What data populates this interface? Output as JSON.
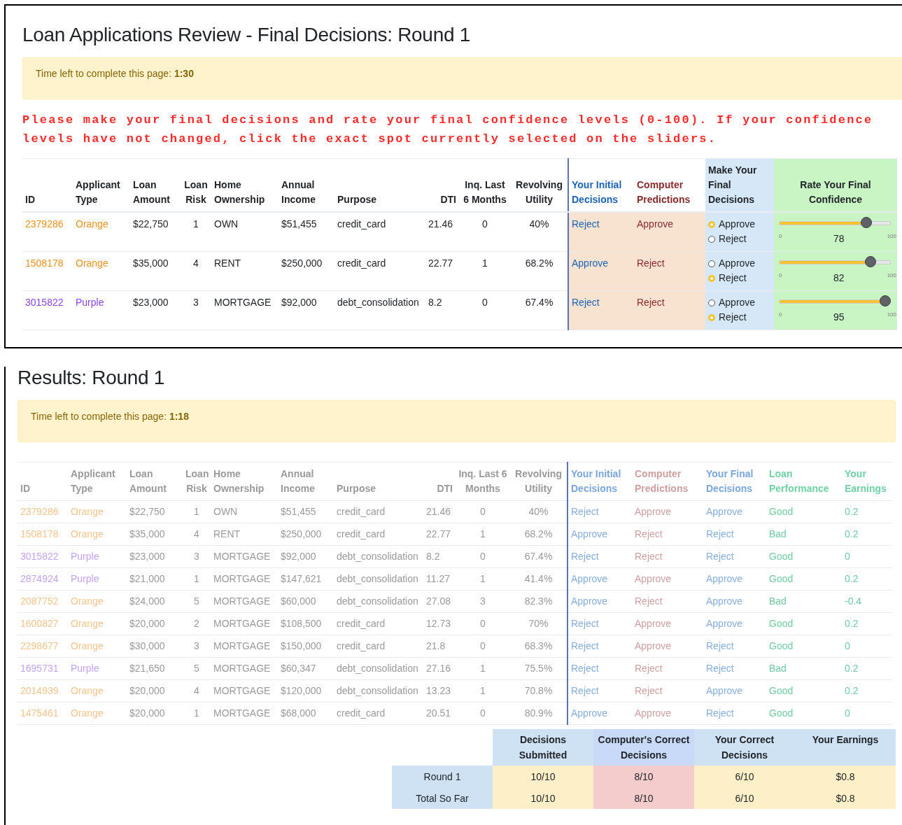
{
  "review": {
    "title": "Loan Applications Review - Final Decisions: Round 1",
    "timer": {
      "label": "Time left to complete this page:",
      "value": "1:30"
    },
    "instructions": "Please make your final decisions and rate your final confidence levels (0-100). If your confidence levels have not changed, click the exact spot currently selected on the sliders.",
    "columns": [
      {
        "label": "ID",
        "kind": "plain"
      },
      {
        "label": "Applicant Type",
        "kind": "plain"
      },
      {
        "label": "Loan Amount",
        "kind": "plain"
      },
      {
        "label": "Loan Risk",
        "kind": "plain"
      },
      {
        "label": "Home Ownership",
        "kind": "plain"
      },
      {
        "label": "Annual Income",
        "kind": "plain"
      },
      {
        "label": "Purpose",
        "kind": "plain"
      },
      {
        "label": "DTI",
        "kind": "plain"
      },
      {
        "label": "Inq. Last 6 Months",
        "kind": "plain"
      },
      {
        "label": "Revolving Utility",
        "kind": "plain"
      },
      {
        "label": "Your Initial Decisions",
        "kind": "initial"
      },
      {
        "label": "Computer Predictions",
        "kind": "computer"
      },
      {
        "label": "Make Your Final Decisions",
        "kind": "final"
      },
      {
        "label": "Rate Your Final Confidence",
        "kind": "confidence"
      }
    ],
    "rows": [
      {
        "color": "#f0901e",
        "cells": [
          "2379286",
          "Orange",
          "$22,750",
          "1",
          "OWN",
          "$51,455",
          "credit_card",
          "21.46",
          "0",
          "40%",
          "Reject",
          "Approve"
        ],
        "final": [
          {
            "label": "Approve",
            "selected": true
          },
          {
            "label": "Reject",
            "selected": false
          }
        ],
        "confidence": {
          "level": 0.78,
          "min": "0",
          "max": "100",
          "reading": "78"
        }
      },
      {
        "color": "#f0901e",
        "cells": [
          "1508178",
          "Orange",
          "$35,000",
          "4",
          "RENT",
          "$250,000",
          "credit_card",
          "22.77",
          "1",
          "68.2%",
          "Approve",
          "Reject"
        ],
        "final": [
          {
            "label": "Approve",
            "selected": false
          },
          {
            "label": "Reject",
            "selected": true
          }
        ],
        "confidence": {
          "level": 0.82,
          "min": "0",
          "max": "100",
          "reading": "82"
        }
      },
      {
        "color": "#8b44f0",
        "cells": [
          "3015822",
          "Purple",
          "$23,000",
          "3",
          "MORTGAGE",
          "$92,000",
          "debt_consolidation",
          "8.2",
          "0",
          "67.4%",
          "Reject",
          "Reject"
        ],
        "final": [
          {
            "label": "Approve",
            "selected": false
          },
          {
            "label": "Reject",
            "selected": true
          }
        ],
        "confidence": {
          "level": 0.95,
          "min": "0",
          "max": "100",
          "reading": "95"
        }
      }
    ]
  },
  "results": {
    "title": "Results: Round 1",
    "timer": {
      "label": "Time left to complete this page:",
      "value": "1:18"
    },
    "columns": [
      {
        "label": "ID",
        "kind": "plain"
      },
      {
        "label": "Applicant Type",
        "kind": "plain"
      },
      {
        "label": "Loan Amount",
        "kind": "plain"
      },
      {
        "label": "Loan Risk",
        "kind": "plain"
      },
      {
        "label": "Home Ownership",
        "kind": "plain"
      },
      {
        "label": "Annual Income",
        "kind": "plain"
      },
      {
        "label": "Purpose",
        "kind": "plain"
      },
      {
        "label": "DTI",
        "kind": "plain"
      },
      {
        "label": "Inq. Last 6 Months",
        "kind": "plain"
      },
      {
        "label": "Revolving Utility",
        "kind": "plain"
      },
      {
        "label": "Your Initial Decisions",
        "kind": "initial"
      },
      {
        "label": "Computer Predictions",
        "kind": "computer"
      },
      {
        "label": "Your Final Decisions",
        "kind": "final"
      },
      {
        "label": "Loan Performance",
        "kind": "performance"
      },
      {
        "label": "Your Earnings",
        "kind": "earnings"
      }
    ],
    "rows": [
      {
        "color": "#f7c48e",
        "cells": [
          "2379286",
          "Orange",
          "$22,750",
          "1",
          "OWN",
          "$51,455",
          "credit_card",
          "21.46",
          "0",
          "40%",
          "Reject",
          "Approve",
          "Approve",
          "Good",
          "0.2"
        ]
      },
      {
        "color": "#f7c48e",
        "cells": [
          "1508178",
          "Orange",
          "$35,000",
          "4",
          "RENT",
          "$250,000",
          "credit_card",
          "22.77",
          "1",
          "68.2%",
          "Approve",
          "Reject",
          "Reject",
          "Bad",
          "0.2"
        ]
      },
      {
        "color": "#c4a3f7",
        "cells": [
          "3015822",
          "Purple",
          "$23,000",
          "3",
          "MORTGAGE",
          "$92,000",
          "debt_consolidation",
          "8.2",
          "0",
          "67.4%",
          "Reject",
          "Reject",
          "Reject",
          "Good",
          "0"
        ]
      },
      {
        "color": "#c4a3f7",
        "cells": [
          "2874924",
          "Purple",
          "$21,000",
          "1",
          "MORTGAGE",
          "$147,621",
          "debt_consolidation",
          "11.27",
          "1",
          "41.4%",
          "Approve",
          "Approve",
          "Approve",
          "Good",
          "0.2"
        ]
      },
      {
        "color": "#f7c48e",
        "cells": [
          "2087752",
          "Orange",
          "$24,000",
          "5",
          "MORTGAGE",
          "$60,000",
          "debt_consolidation",
          "27.08",
          "3",
          "82.3%",
          "Approve",
          "Reject",
          "Approve",
          "Bad",
          "-0.4"
        ]
      },
      {
        "color": "#f7c48e",
        "cells": [
          "1600827",
          "Orange",
          "$20,000",
          "2",
          "MORTGAGE",
          "$108,500",
          "credit_card",
          "12.73",
          "0",
          "70%",
          "Reject",
          "Approve",
          "Approve",
          "Good",
          "0.2"
        ]
      },
      {
        "color": "#f7c48e",
        "cells": [
          "2298677",
          "Orange",
          "$30,000",
          "3",
          "MORTGAGE",
          "$150,000",
          "credit_card",
          "21.8",
          "0",
          "68.3%",
          "Reject",
          "Approve",
          "Reject",
          "Good",
          "0"
        ]
      },
      {
        "color": "#c4a3f7",
        "cells": [
          "1695731",
          "Purple",
          "$21,650",
          "5",
          "MORTGAGE",
          "$60,347",
          "debt_consolidation",
          "27.16",
          "1",
          "75.5%",
          "Reject",
          "Reject",
          "Reject",
          "Bad",
          "0.2"
        ]
      },
      {
        "color": "#f7c48e",
        "cells": [
          "2014939",
          "Orange",
          "$20,000",
          "4",
          "MORTGAGE",
          "$120,000",
          "debt_consolidation",
          "13.23",
          "1",
          "70.8%",
          "Reject",
          "Reject",
          "Approve",
          "Good",
          "0.2"
        ]
      },
      {
        "color": "#f7c48e",
        "cells": [
          "1475461",
          "Orange",
          "$20,000",
          "1",
          "MORTGAGE",
          "$68,000",
          "credit_card",
          "20.51",
          "0",
          "80.9%",
          "Approve",
          "Approve",
          "Reject",
          "Good",
          "0"
        ]
      }
    ],
    "summary": {
      "columns": [
        {
          "label": "Decisions Submitted",
          "kind": "plain"
        },
        {
          "label": "Computer's Correct Decisions",
          "kind": "computer"
        },
        {
          "label": "Your Correct Decisions",
          "kind": "plain"
        },
        {
          "label": "Your Earnings",
          "kind": "plain"
        }
      ],
      "rows": [
        {
          "label": "Round 1",
          "cells": [
            "10/10",
            "8/10",
            "6/10",
            "$0.8"
          ]
        },
        {
          "label": "Total So Far",
          "cells": [
            "10/10",
            "8/10",
            "6/10",
            "$0.8"
          ]
        }
      ]
    }
  }
}
